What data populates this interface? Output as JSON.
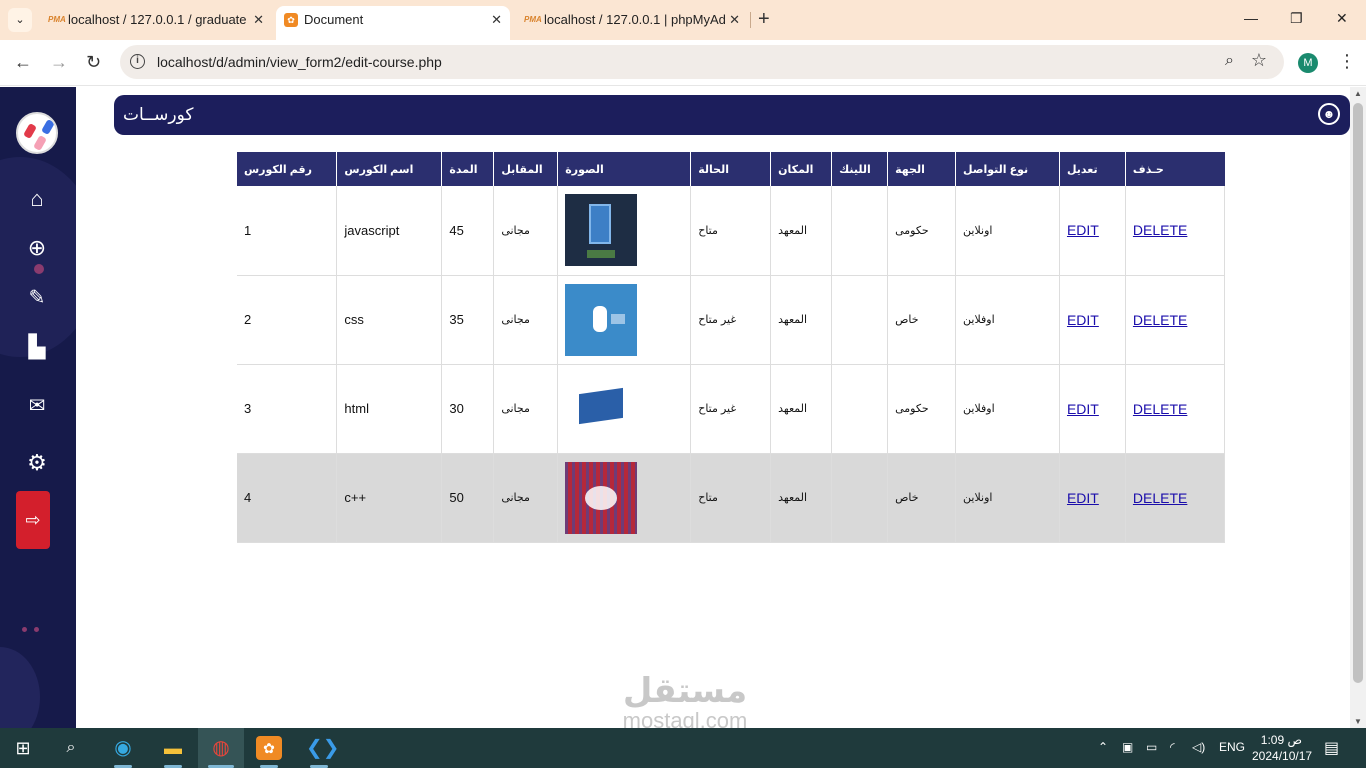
{
  "browser": {
    "tabs": [
      {
        "title": "localhost / 127.0.0.1 / graduate",
        "favicon": "pma-icon"
      },
      {
        "title": "Document",
        "favicon": "xampp-icon"
      },
      {
        "title": "localhost / 127.0.0.1 | phpMyAd",
        "favicon": "pma-icon"
      }
    ],
    "pma_label": "PMA",
    "close_glyph": "✕",
    "new_tab_glyph": "+",
    "menu_glyph": "⌄",
    "url": "localhost/d/admin/view_form2/edit-course.php",
    "profile_initial": "M"
  },
  "header": {
    "title": "كورســات"
  },
  "sidebar": {
    "items": [
      {
        "name": "home-icon",
        "glyph": "⌂"
      },
      {
        "name": "add-icon",
        "glyph": "⊕"
      },
      {
        "name": "edit-icon",
        "glyph": "✎"
      },
      {
        "name": "chart-icon",
        "glyph": "▙"
      },
      {
        "name": "mail-icon",
        "glyph": "✉"
      },
      {
        "name": "settings-icon",
        "glyph": "⚙"
      },
      {
        "name": "logout-icon",
        "glyph": "⇨"
      }
    ]
  },
  "table": {
    "columns": [
      "رقم الكورس",
      "اسم الكورس",
      "المدة",
      "المقابل",
      "الصورة",
      "الحالة",
      "المكان",
      "اللينك",
      "الجهة",
      "نوع التواصل",
      "تعديل",
      "حـذف"
    ],
    "rows": [
      {
        "id": "1",
        "name": "javascript",
        "duration": "45",
        "price": "مجانى",
        "image": "javascript-image",
        "status": "متاح",
        "place": "المعهد",
        "link": "",
        "org": "حكومى",
        "contact": "اونلاين",
        "edit": "EDIT",
        "delete": "DELETE"
      },
      {
        "id": "2",
        "name": "css",
        "duration": "35",
        "price": "مجانى",
        "image": "css-image",
        "status": "غير متاح",
        "place": "المعهد",
        "link": "",
        "org": "خاص",
        "contact": "اوفلاين",
        "edit": "EDIT",
        "delete": "DELETE"
      },
      {
        "id": "3",
        "name": "html",
        "duration": "30",
        "price": "مجانى",
        "image": "html-image",
        "status": "غير متاح",
        "place": "المعهد",
        "link": "",
        "org": "حكومى",
        "contact": "اوفلاين",
        "edit": "EDIT",
        "delete": "DELETE"
      },
      {
        "id": "4",
        "name": "c++",
        "duration": "50",
        "price": "مجانى",
        "image": "cpp-image",
        "status": "متاح",
        "place": "المعهد",
        "link": "",
        "org": "خاص",
        "contact": "اونلاين",
        "edit": "EDIT",
        "delete": "DELETE"
      }
    ]
  },
  "watermark": {
    "arabic": "مستقل",
    "latin": "mostaql.com"
  },
  "taskbar": {
    "language": "ENG",
    "time": "1:09 ص",
    "date": "2024/10/17"
  },
  "colors": {
    "sidebar": "#161a4a",
    "header": "#1c1e5c",
    "table_header": "#2b2f6f",
    "logout": "#d31f2c",
    "link": "#1a0dab"
  }
}
